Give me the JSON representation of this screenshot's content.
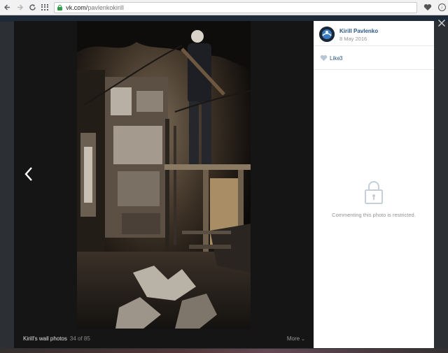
{
  "browser": {
    "url_host": "vk.com/",
    "url_path": "pavlenkokirill"
  },
  "viewer": {
    "album_title": "Kirill's wall photos",
    "position_text": "34 of 85",
    "more_label": "More",
    "photo": {
      "description": "Dark photo of a person standing on scaffolding inside a charred, burned room"
    }
  },
  "sidebar": {
    "author_name": "Kirill Pavlenko",
    "author_date": "8 May 2016",
    "like_label": "Like",
    "like_count": "3",
    "restricted_text": "Commenting this photo is restricted."
  },
  "colors": {
    "link_blue": "#2a5885",
    "muted_gray": "#939393",
    "viewer_bg": "#151515",
    "secure_green": "#2e9f47"
  }
}
